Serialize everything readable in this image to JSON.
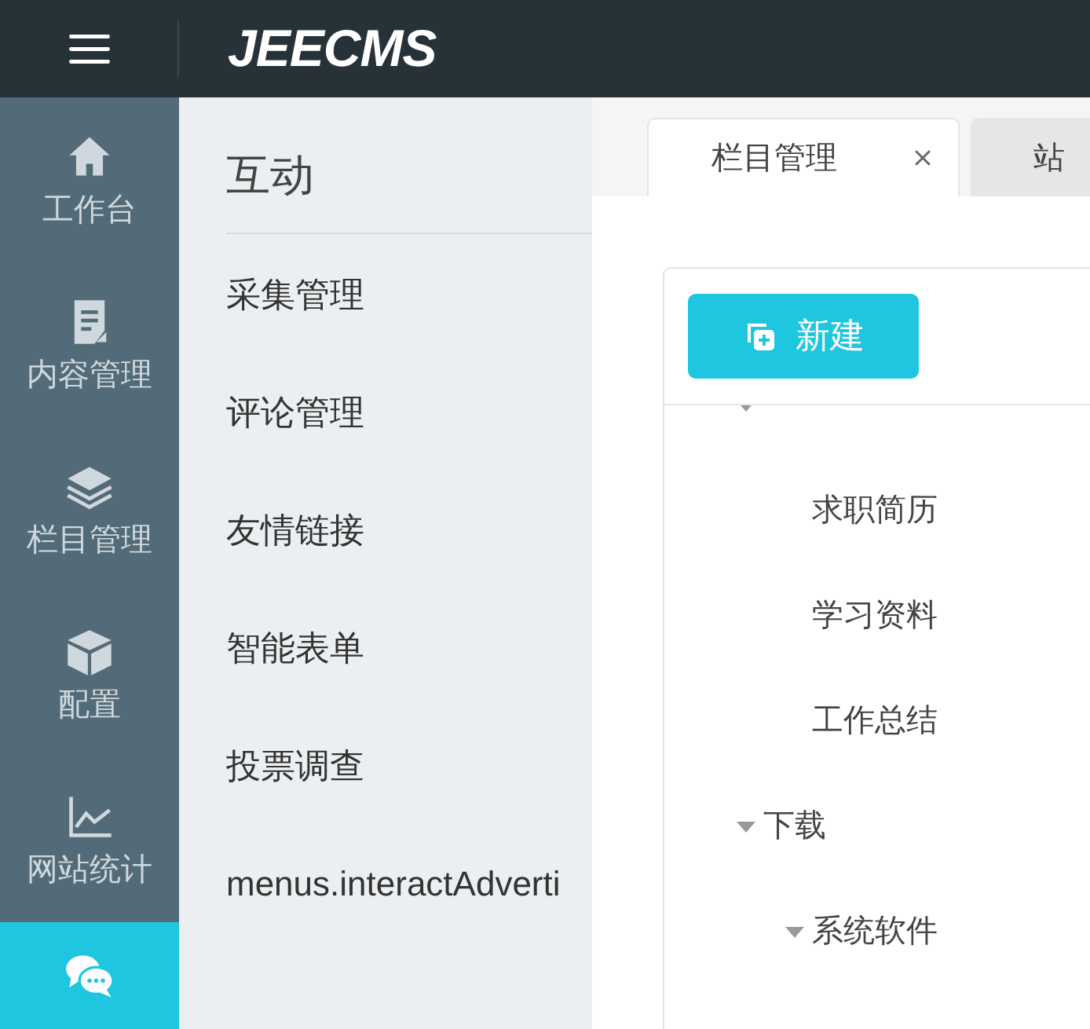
{
  "header": {
    "logo": "JEECMS"
  },
  "sidebar": {
    "items": [
      {
        "label": "工作台",
        "selected": false
      },
      {
        "label": "内容管理",
        "selected": false
      },
      {
        "label": "栏目管理",
        "selected": false
      },
      {
        "label": "配置",
        "selected": false
      },
      {
        "label": "网站统计",
        "selected": false
      },
      {
        "selected": true
      }
    ]
  },
  "submenu": {
    "title": "互动",
    "items": [
      "采集管理",
      "评论管理",
      "友情链接",
      "智能表单",
      "投票调查",
      "menus.interactAdverti"
    ]
  },
  "tabs": [
    {
      "label": "栏目管理",
      "selected": true,
      "closable": true
    },
    {
      "label": "站",
      "selected": false,
      "closable": false
    }
  ],
  "toolbar": {
    "new_button": "新建"
  },
  "tree": [
    {
      "expanded": true,
      "children": [
        {
          "label": "求职简历"
        },
        {
          "label": "学习资料"
        },
        {
          "label": "工作总结"
        }
      ]
    },
    {
      "label": "下载",
      "expanded": true,
      "children": [
        {
          "label": "系统软件",
          "expanded": true
        }
      ]
    }
  ]
}
